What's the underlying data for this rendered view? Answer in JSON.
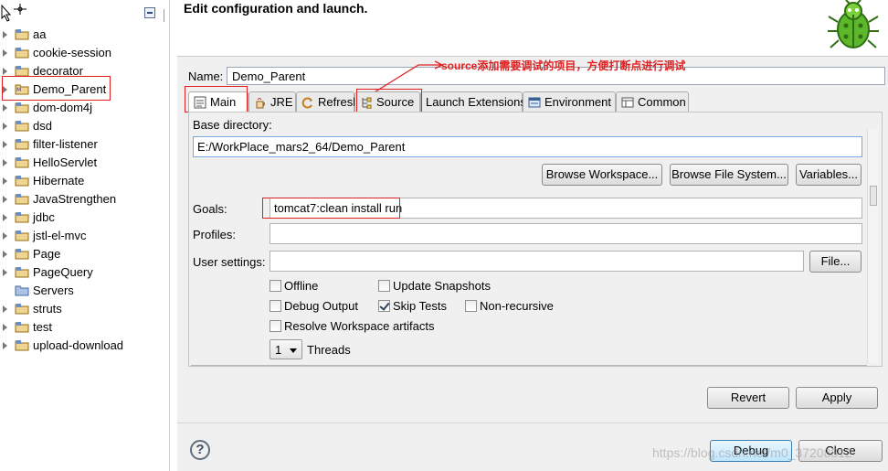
{
  "explorer": {
    "items": [
      {
        "label": "aa",
        "icon": "project-folder-icon"
      },
      {
        "label": "cookie-session",
        "icon": "project-folder-icon"
      },
      {
        "label": "decorator",
        "icon": "project-folder-icon"
      },
      {
        "label": "Demo_Parent",
        "icon": "maven-project-icon"
      },
      {
        "label": "dom-dom4j",
        "icon": "project-folder-icon"
      },
      {
        "label": "dsd",
        "icon": "project-folder-icon"
      },
      {
        "label": "filter-listener",
        "icon": "project-folder-icon"
      },
      {
        "label": "HelloServlet",
        "icon": "project-folder-icon"
      },
      {
        "label": "Hibernate",
        "icon": "project-folder-icon"
      },
      {
        "label": "JavaStrengthen",
        "icon": "project-folder-icon"
      },
      {
        "label": "jdbc",
        "icon": "project-folder-icon"
      },
      {
        "label": "jstl-el-mvc",
        "icon": "project-folder-icon"
      },
      {
        "label": "Page",
        "icon": "project-folder-icon"
      },
      {
        "label": "PageQuery",
        "icon": "project-folder-icon"
      },
      {
        "label": "Servers",
        "icon": "folder-icon"
      },
      {
        "label": "struts",
        "icon": "project-folder-icon"
      },
      {
        "label": "test",
        "icon": "project-folder-icon"
      },
      {
        "label": "upload-download",
        "icon": "project-folder-icon"
      }
    ]
  },
  "dialog": {
    "title": "Edit configuration and launch.",
    "name_label": "Name:",
    "name_value": "Demo_Parent",
    "annotation": "source添加需要调试的项目，方便打断点进行调试",
    "tabs": [
      {
        "label": "Main",
        "icon": "main-tab-icon",
        "active": true
      },
      {
        "label": "JRE",
        "icon": "jre-icon",
        "active": false
      },
      {
        "label": "Refresh",
        "icon": "refresh-icon",
        "active": false
      },
      {
        "label": "Source",
        "icon": "source-icon",
        "active": false
      },
      {
        "label": "Launch Extensions",
        "icon": "",
        "active": false
      },
      {
        "label": "Environment",
        "icon": "environment-icon",
        "active": false
      },
      {
        "label": "Common",
        "icon": "common-icon",
        "active": false
      }
    ],
    "main": {
      "base_dir_label": "Base directory:",
      "base_dir_value": "E:/WorkPlace_mars2_64/Demo_Parent",
      "browse_workspace": "Browse Workspace...",
      "browse_fs": "Browse File System...",
      "variables": "Variables...",
      "goals_label": "Goals:",
      "goals_value": "tomcat7:clean install run",
      "profiles_label": "Profiles:",
      "profiles_value": "",
      "user_settings_label": "User settings:",
      "user_settings_value": "",
      "file_button": "File...",
      "options": {
        "offline": {
          "label": "Offline",
          "checked": false
        },
        "update_snapshots": {
          "label": "Update Snapshots",
          "checked": false
        },
        "debug_output": {
          "label": "Debug Output",
          "checked": false
        },
        "skip_tests": {
          "label": "Skip Tests",
          "checked": true
        },
        "non_recursive": {
          "label": "Non-recursive",
          "checked": false
        },
        "resolve_workspace": {
          "label": "Resolve Workspace artifacts",
          "checked": false
        }
      },
      "threads_value": "1",
      "threads_label": "Threads"
    },
    "buttons": {
      "revert": "Revert",
      "apply": "Apply",
      "debug": "Debug",
      "close": "Close"
    },
    "watermark": "https://blog.csdn.net/m0_37208812"
  }
}
